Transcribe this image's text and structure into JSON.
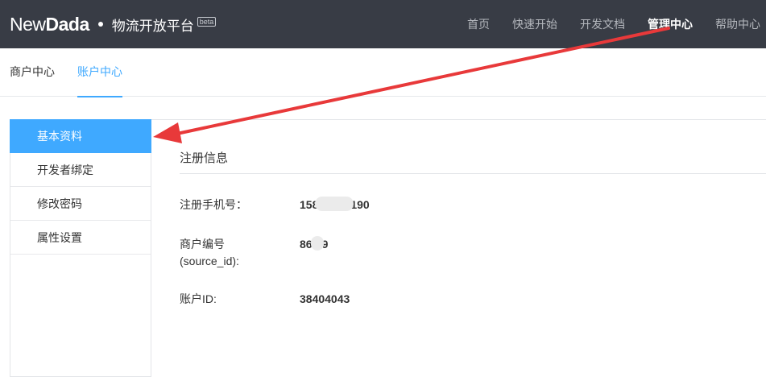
{
  "header": {
    "logo_light": "New",
    "logo_bold": "Dada",
    "platform_name": "物流开放平台",
    "beta_badge": "beta",
    "nav": [
      {
        "label": "首页"
      },
      {
        "label": "快速开始"
      },
      {
        "label": "开发文档"
      },
      {
        "label": "管理中心",
        "active": true
      },
      {
        "label": "帮助中心"
      }
    ]
  },
  "subtabs": [
    {
      "label": "商户中心"
    },
    {
      "label": "账户中心",
      "active": true
    }
  ],
  "sidebar": {
    "items": [
      {
        "label": "基本资料",
        "active": true
      },
      {
        "label": "开发者绑定"
      },
      {
        "label": "修改密码"
      },
      {
        "label": "属性设置"
      }
    ]
  },
  "main": {
    "section_title": "注册信息",
    "rows": [
      {
        "label": "注册手机号：",
        "value_prefix": "158",
        "value_suffix": "190"
      },
      {
        "label_line1": "商户编号",
        "label_line2": "(source_id):",
        "value_prefix": "86",
        "value_suffix": "9"
      },
      {
        "label": "账户ID:",
        "value": "38404043"
      }
    ]
  },
  "colors": {
    "header_bg": "#383c45",
    "accent": "#3fa9ff",
    "annotation_arrow": "#e8393a"
  }
}
